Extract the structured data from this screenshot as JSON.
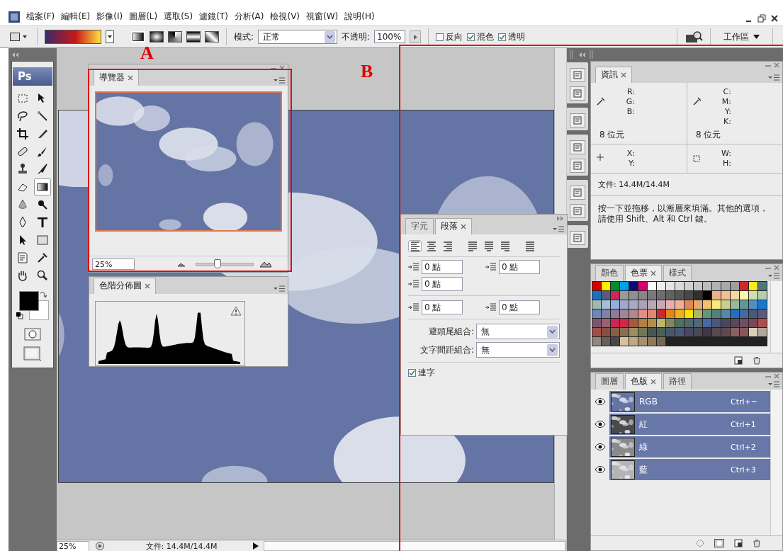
{
  "menu_bar": {
    "items": [
      "檔案(F)",
      "編輯(E)",
      "影像(I)",
      "圖層(L)",
      "選取(S)",
      "濾鏡(T)",
      "分析(A)",
      "檢視(V)",
      "視窗(W)",
      "說明(H)"
    ]
  },
  "options_bar": {
    "gradient_types": [
      {
        "selected": true
      },
      {
        "selected": false
      },
      {
        "selected": false
      },
      {
        "selected": false
      },
      {
        "selected": false
      }
    ],
    "mode_label": "模式:",
    "mode": "正常",
    "opacity_label": "不透明:",
    "opacity": "100%",
    "checkboxes": [
      {
        "label": "反向",
        "checked": false
      },
      {
        "label": "混色",
        "checked": true
      },
      {
        "label": "透明",
        "checked": true
      }
    ],
    "workspace": "工作區"
  },
  "toolbox": {
    "logo": "Ps",
    "tools": [
      {
        "selected": false
      },
      {
        "selected": false
      },
      {
        "selected": false
      },
      {
        "selected": false
      },
      {
        "selected": false
      },
      {
        "selected": false
      },
      {
        "selected": false
      },
      {
        "selected": false
      },
      {
        "selected": false
      },
      {
        "selected": false
      },
      {
        "selected": false
      },
      {
        "selected": true
      },
      {
        "selected": false
      },
      {
        "selected": false
      },
      {
        "selected": false
      },
      {
        "selected": false
      },
      {
        "selected": false
      },
      {
        "selected": false
      },
      {
        "selected": false
      },
      {
        "selected": false
      },
      {
        "selected": false
      },
      {
        "selected": false
      }
    ]
  },
  "navigator": {
    "tab": "導覽器",
    "zoom": "25%",
    "level": 0.37
  },
  "histogram": {
    "tab": "色階分佈圖"
  },
  "paragraph": {
    "tabs": [
      {
        "label": "字元",
        "selected": false
      },
      {
        "label": "段落",
        "selected": true
      }
    ],
    "alignment": [
      {
        "selected": true
      },
      {
        "selected": false
      },
      {
        "selected": false
      },
      {
        "selected": false
      },
      {
        "selected": false
      },
      {
        "selected": false
      },
      {
        "selected": false
      }
    ],
    "fields": [
      "0 點",
      "0 點",
      "0 點",
      "0 點",
      "0 點"
    ],
    "dropdowns": [
      {
        "label": "避頭尾組合:",
        "value": "無"
      },
      {
        "label": "文字間距組合:",
        "value": "無"
      }
    ],
    "hyphenate": {
      "label": "連字",
      "checked": true
    }
  },
  "info": {
    "tab": "資訊",
    "rgb_labels": [
      "R:",
      "G:",
      "B:"
    ],
    "cmyk_labels": [
      "C:",
      "M:",
      "Y:",
      "K:"
    ],
    "bit_depth": [
      "8 位元",
      "8 位元"
    ],
    "xy_labels": [
      "X:",
      "Y:"
    ],
    "wh_labels": [
      "W:",
      "H:"
    ],
    "document": "文件: 14.4M/14.4M",
    "hint": "按一下並拖移，以漸層來填滿。其他的選項，請使用 Shift、Alt 和 Ctrl 鍵。"
  },
  "swatches_panel": {
    "tabs": [
      {
        "label": "顏色",
        "selected": false
      },
      {
        "label": "色票",
        "selected": true
      },
      {
        "label": "樣式",
        "selected": false
      }
    ],
    "swatches": [
      {
        "color": "#d40000"
      },
      {
        "color": "#ffee00"
      },
      {
        "color": "#00902a"
      },
      {
        "color": "#00a0e8"
      },
      {
        "color": "#0a0a78"
      },
      {
        "color": "#d4006e"
      },
      {
        "color": "#ffffff"
      },
      {
        "color": "#efefef"
      },
      {
        "color": "#e4e4e4"
      },
      {
        "color": "#dadada"
      },
      {
        "color": "#d0d0d0"
      },
      {
        "color": "#c6c6c6"
      },
      {
        "color": "#bcbcbc"
      },
      {
        "color": "#b2b2b2"
      },
      {
        "color": "#a8a8a8"
      },
      {
        "color": "#9e9e9e"
      },
      {
        "color": "#cc2a2a"
      },
      {
        "color": "#ffe81a"
      },
      {
        "color": "#4a7a78"
      },
      {
        "color": "#1a70c0"
      },
      {
        "color": "#5a5a80"
      },
      {
        "color": "#c8285a"
      },
      {
        "color": "#9a9a9a"
      },
      {
        "color": "#909090"
      },
      {
        "color": "#868686"
      },
      {
        "color": "#7a7a7a"
      },
      {
        "color": "#6e6e6e"
      },
      {
        "color": "#626262"
      },
      {
        "color": "#565656"
      },
      {
        "color": "#484848"
      },
      {
        "color": "#303030"
      },
      {
        "color": "#000000"
      },
      {
        "color": "#eeb088"
      },
      {
        "color": "#f0c090"
      },
      {
        "color": "#f5d8a0"
      },
      {
        "color": "#fff5b0"
      },
      {
        "color": "#d0ddb0"
      },
      {
        "color": "#b8ccb0"
      },
      {
        "color": "#a0b8b0"
      },
      {
        "color": "#a0c0d8"
      },
      {
        "color": "#90b0e0"
      },
      {
        "color": "#a0a8c8"
      },
      {
        "color": "#a8a8c8"
      },
      {
        "color": "#b0a0b8"
      },
      {
        "color": "#b8a8b8"
      },
      {
        "color": "#c8a8b8"
      },
      {
        "color": "#e8b0b0"
      },
      {
        "color": "#eeb098"
      },
      {
        "color": "#e08858"
      },
      {
        "color": "#e8a868"
      },
      {
        "color": "#f0c070"
      },
      {
        "color": "#f8e880"
      },
      {
        "color": "#c8d090"
      },
      {
        "color": "#98b898"
      },
      {
        "color": "#609898"
      },
      {
        "color": "#5090c0"
      },
      {
        "color": "#1878d0"
      },
      {
        "color": "#7088b8"
      },
      {
        "color": "#8080a8"
      },
      {
        "color": "#907898"
      },
      {
        "color": "#a08898"
      },
      {
        "color": "#b08890"
      },
      {
        "color": "#e09088"
      },
      {
        "color": "#e08870"
      },
      {
        "color": "#d02828"
      },
      {
        "color": "#e08820"
      },
      {
        "color": "#f0b020"
      },
      {
        "color": "#ffe000"
      },
      {
        "color": "#a8b868"
      },
      {
        "color": "#609878"
      },
      {
        "color": "#508080"
      },
      {
        "color": "#5888a8"
      },
      {
        "color": "#2070c0"
      },
      {
        "color": "#4868a0"
      },
      {
        "color": "#485880"
      },
      {
        "color": "#605878"
      },
      {
        "color": "#785870"
      },
      {
        "color": "#986070"
      },
      {
        "color": "#c82858"
      },
      {
        "color": "#d02848"
      },
      {
        "color": "#a85840"
      },
      {
        "color": "#b08048"
      },
      {
        "color": "#b09050"
      },
      {
        "color": "#c0b868"
      },
      {
        "color": "#808860"
      },
      {
        "color": "#507060"
      },
      {
        "color": "#506868"
      },
      {
        "color": "#506878"
      },
      {
        "color": "#4868a0"
      },
      {
        "color": "#485878"
      },
      {
        "color": "#484860"
      },
      {
        "color": "#584858"
      },
      {
        "color": "#705060"
      },
      {
        "color": "#784858"
      },
      {
        "color": "#a85050"
      },
      {
        "color": "#a05048"
      },
      {
        "color": "#885040"
      },
      {
        "color": "#886048"
      },
      {
        "color": "#887050"
      },
      {
        "color": "#989060"
      },
      {
        "color": "#707858"
      },
      {
        "color": "#485850"
      },
      {
        "color": "#486058"
      },
      {
        "color": "#485868"
      },
      {
        "color": "#485878"
      },
      {
        "color": "#484860"
      },
      {
        "color": "#484858"
      },
      {
        "color": "#403848"
      },
      {
        "color": "#584850"
      },
      {
        "color": "#604850"
      },
      {
        "color": "#886060"
      },
      {
        "color": "#885858"
      },
      {
        "color": "#d8d0b8"
      },
      {
        "color": "#b0a898"
      },
      {
        "color": "#908880"
      },
      {
        "color": "#686058"
      },
      {
        "color": "#484848"
      },
      {
        "color": "#d8c098"
      },
      {
        "color": "#c0a880"
      },
      {
        "color": "#a89070"
      },
      {
        "color": "#907858"
      },
      {
        "color": "#786850"
      }
    ]
  },
  "channels_panel": {
    "tabs": [
      {
        "label": "圖層",
        "selected": false
      },
      {
        "label": "色版",
        "selected": true
      },
      {
        "label": "路徑",
        "selected": false
      }
    ],
    "channels": [
      {
        "name": "RGB",
        "shortcut": "Ctrl+~",
        "visible": true,
        "selected": true
      },
      {
        "name": "紅",
        "shortcut": "Ctrl+1",
        "visible": true,
        "selected": true
      },
      {
        "name": "綠",
        "shortcut": "Ctrl+2",
        "visible": true,
        "selected": true
      },
      {
        "name": "藍",
        "shortcut": "Ctrl+3",
        "visible": true,
        "selected": true
      }
    ]
  },
  "status_bar": {
    "zoom": "25%",
    "document": "文件: 14.4M/14.4M"
  },
  "annotations": [
    "A",
    "B"
  ]
}
